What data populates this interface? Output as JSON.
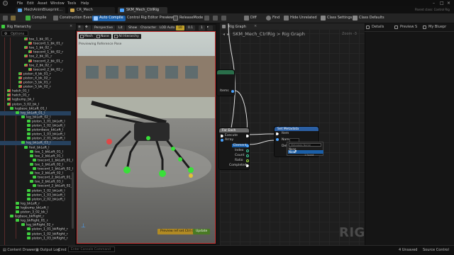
{
  "menubar": {
    "items": [
      "File",
      "Edit",
      "Asset",
      "Window",
      "Tools",
      "Help"
    ]
  },
  "tabs": [
    {
      "label": "MechAnimBlueprint…",
      "active": false
    },
    {
      "label": "CR_Mech",
      "active": false
    },
    {
      "label": "SKM_Mech_CtrlRig",
      "active": true
    }
  ],
  "toolbar": {
    "compile": "Compile",
    "construction_event": "Construction Event",
    "auto_compile": "Auto Compile",
    "control_rig_preview": "Control Rig Editor Preview",
    "release_mode": "ReleaseMode",
    "diff": "Diff",
    "find": "Find",
    "hide_unrelated": "Hide Unrelated",
    "class_settings": "Class Settings",
    "class_defaults": "Class Defaults",
    "parent_class": "Parent class: Control Rig"
  },
  "left_panel": {
    "title": "Rig Hierarchy",
    "search_placeholder": "Search",
    "options": "Options",
    "items": [
      {
        "label": "toe_1_bk_01_r"
      },
      {
        "label": "toecord_1_bk_01_r"
      },
      {
        "label": "toe_1_bk_02_r"
      },
      {
        "label": "toecord_1_bk_02_r"
      },
      {
        "label": "toe_2_bk_01_r"
      },
      {
        "label": "toecord_2_bk_01_r"
      },
      {
        "label": "toe_2_bk_02_r"
      },
      {
        "label": "toecord_2_bk_02_r"
      },
      {
        "label": "piston_4_bk_01_r"
      },
      {
        "label": "piston_4_bk_02_r"
      },
      {
        "label": "piston_5_bk_01_r"
      },
      {
        "label": "piston_5_bk_02_r"
      },
      {
        "label": "hatch_01_l"
      },
      {
        "label": "hatch_01_r"
      },
      {
        "label": "legbump_bk_l"
      },
      {
        "label": "piston_3_02_bk_l"
      },
      {
        "label": "legbase_bkLeft_01_l"
      },
      {
        "label": "leg_bkLeft_01_l"
      },
      {
        "label": "leg_bkLeft_02_l"
      },
      {
        "label": "piston_1_01_bkLeft_l"
      },
      {
        "label": "piston_1_02_bkLeft_l"
      },
      {
        "label": "pistonbase_bkLeft_l"
      },
      {
        "label": "piston_1_03_bkLeft_l"
      },
      {
        "label": "piston_2_01_bkLeft_l"
      },
      {
        "label": "leg_bkLeft_03_l"
      },
      {
        "label": "foot_bkLeft_l"
      },
      {
        "label": "toe_1_bkLeft_01_l"
      },
      {
        "label": "toe_2_bkLeft_01_l"
      },
      {
        "label": "toecord_1_bkLeft_01_l"
      },
      {
        "label": "toe_1_bkLeft_02_l"
      },
      {
        "label": "toecord_1_bkLeft_02_l"
      },
      {
        "label": "toe_2_bkLeft_02_l"
      },
      {
        "label": "toecord_2_bkLeft_01_l"
      },
      {
        "label": "toe_2_bkLeft_03_l"
      },
      {
        "label": "toecord_2_bkLeft_02_l"
      },
      {
        "label": "piston_1_02_bkLeft_l"
      },
      {
        "label": "piston_1_03_bkLeft_l"
      },
      {
        "label": "piston_2_02_bkLeft_l"
      },
      {
        "label": "leg_bkLeft_r"
      },
      {
        "label": "legbump_bkLeft_l"
      },
      {
        "label": "piston_3_02_bk_l"
      },
      {
        "label": "legbase_bkRight_r"
      },
      {
        "label": "leg_bkRight_01_r"
      },
      {
        "label": "leg_bkRight_02_r"
      },
      {
        "label": "piston_1_01_bkRight_r"
      },
      {
        "label": "piston_1_02_bkRight_r"
      },
      {
        "label": "piston_1_03_bkRight_r"
      }
    ]
  },
  "viewport": {
    "perspective": "Perspective",
    "lit": "Lit",
    "show": "Show",
    "character": "Character",
    "lod": "LOD Auto",
    "value_a": "10",
    "value_b": "0.1",
    "value_c": "1",
    "mesh": "Mesh",
    "none": "None",
    "all_hierarchy": "All Hierarchy",
    "ref_pose": "Previewing Reference Pose",
    "btn_reset": "Preview ref set Ctrl data",
    "btn_update": "Update"
  },
  "graph": {
    "tab": "Rig Graph",
    "breadcrumb_root": "SKM_Mech_CtrlRig",
    "breadcrumb_sep": ">",
    "breadcrumb_leaf": "Rig Graph",
    "zoom": "Zoom -3",
    "watermark": "RIG",
    "upper_node": {
      "items": "Items"
    },
    "for_each": {
      "title": "For Each",
      "execute": "Execute",
      "array": "Array",
      "element": "Element",
      "index": "Index",
      "count": "Count",
      "ratio": "Ratio",
      "completed": "Completed"
    },
    "set_metadata": {
      "title": "Set Metadata",
      "item": "Item",
      "name": "Name",
      "default": "Default"
    },
    "dropdown": {
      "search": "Metadata Name",
      "options": [
        "None",
        "None"
      ],
      "found": "1 found"
    }
  },
  "right_panel": {
    "tabs": [
      "Details",
      "Preview S",
      "My Bluepr"
    ]
  },
  "status": {
    "content_drawer": "Content Drawer",
    "output_log": "Output Log",
    "cmd": "Cmd",
    "cmd_placeholder": "Enter Console Command",
    "unsaved": "4 Unsaved",
    "source_control": "Source Control"
  },
  "colors": {
    "accent": "#1b5fa8",
    "for_each_header": "#6b6b6b",
    "set_metadata_header": "#2b5fa3",
    "viewport_border": "#c73232"
  }
}
